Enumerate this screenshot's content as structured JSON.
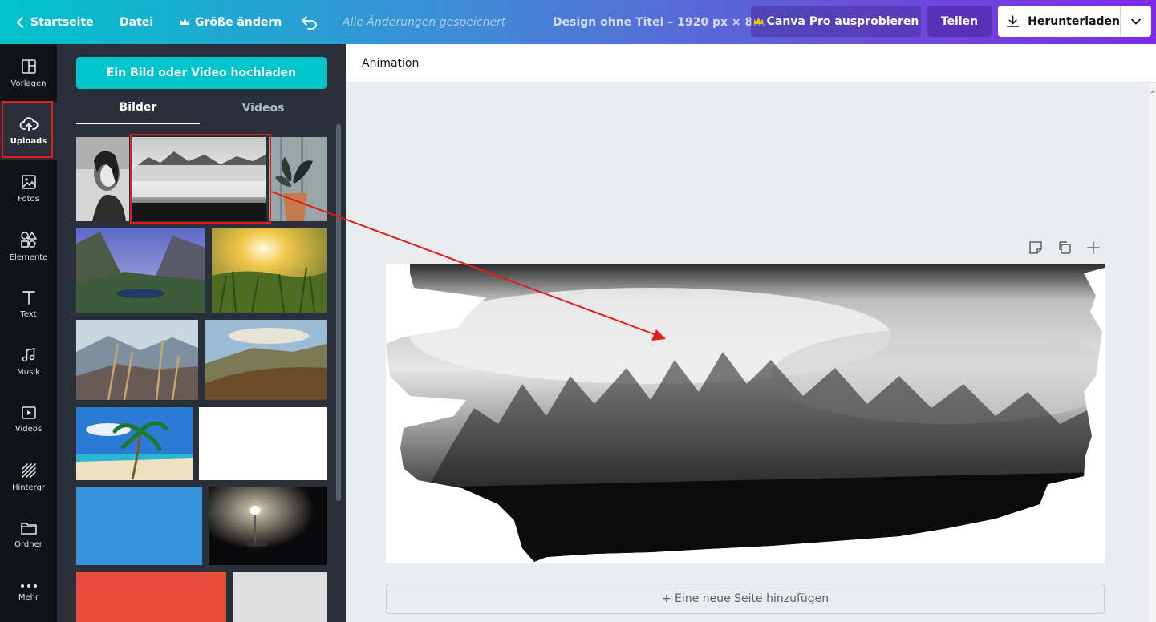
{
  "topbar": {
    "home_label": "Startseite",
    "file_label": "Datei",
    "resize_label": "Größe ändern",
    "saved_status": "Alle Änderungen gespeichert",
    "design_title": "Design ohne Titel – 1920 px × 8...",
    "pro_label": "Canva Pro ausprobieren",
    "share_label": "Teilen",
    "download_label": "Herunterladen"
  },
  "rail": {
    "items": [
      {
        "label": "Vorlagen",
        "icon": "templates-icon"
      },
      {
        "label": "Uploads",
        "icon": "cloud-upload-icon"
      },
      {
        "label": "Fotos",
        "icon": "photo-icon"
      },
      {
        "label": "Elemente",
        "icon": "elements-icon"
      },
      {
        "label": "Text",
        "icon": "text-icon"
      },
      {
        "label": "Musik",
        "icon": "music-icon"
      },
      {
        "label": "Videos",
        "icon": "video-icon"
      },
      {
        "label": "Hintergr",
        "icon": "background-icon"
      },
      {
        "label": "Ordner",
        "icon": "folder-icon"
      },
      {
        "label": "Mehr",
        "icon": "more-icon"
      }
    ],
    "active": "Uploads"
  },
  "panel": {
    "upload_button": "Ein Bild oder Video hochladen",
    "tabs": [
      {
        "label": "Bilder",
        "active": true
      },
      {
        "label": "Videos",
        "active": false
      }
    ]
  },
  "editor": {
    "animation_label": "Animation",
    "add_page_label": "+ Eine neue Seite hinzufügen"
  },
  "colors": {
    "accent": "#00c4cc",
    "highlight": "#e31b1b",
    "rail_bg": "#0e1318",
    "panel_bg": "#293039"
  }
}
